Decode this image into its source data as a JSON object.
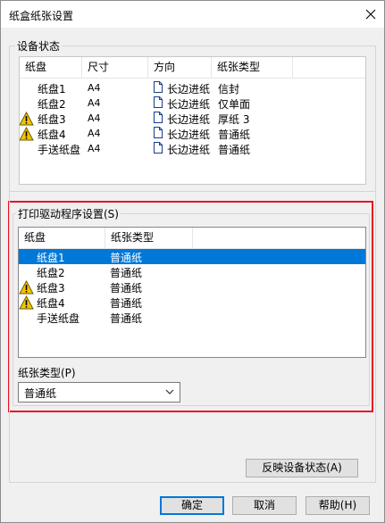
{
  "window": {
    "title": "纸盒纸张设置"
  },
  "device_status": {
    "group_label": "设备状态",
    "columns": [
      "纸盘",
      "尺寸",
      "方向",
      "纸张类型"
    ],
    "rows": [
      {
        "tray": "纸盘1",
        "size": "A4",
        "orientation": "长边进纸",
        "paper": "信封",
        "warning": false
      },
      {
        "tray": "纸盘2",
        "size": "A4",
        "orientation": "长边进纸",
        "paper": "仅单面",
        "warning": false
      },
      {
        "tray": "纸盘3",
        "size": "A4",
        "orientation": "长边进纸",
        "paper": "厚纸 3",
        "warning": true
      },
      {
        "tray": "纸盘4",
        "size": "A4",
        "orientation": "长边进纸",
        "paper": "普通纸",
        "warning": true
      },
      {
        "tray": "手送纸盘",
        "size": "A4",
        "orientation": "长边进纸",
        "paper": "普通纸",
        "warning": false
      }
    ]
  },
  "driver_settings": {
    "group_label": "打印驱动程序设置(S)",
    "columns": [
      "纸盘",
      "纸张类型"
    ],
    "rows": [
      {
        "tray": "纸盘1",
        "paper": "普通纸",
        "warning": false,
        "selected": true
      },
      {
        "tray": "纸盘2",
        "paper": "普通纸",
        "warning": false,
        "selected": false
      },
      {
        "tray": "纸盘3",
        "paper": "普通纸",
        "warning": true,
        "selected": false
      },
      {
        "tray": "纸盘4",
        "paper": "普通纸",
        "warning": true,
        "selected": false
      },
      {
        "tray": "手送纸盘",
        "paper": "普通纸",
        "warning": false,
        "selected": false
      }
    ],
    "paper_type_label": "纸张类型(P)",
    "paper_type_value": "普通纸"
  },
  "buttons": {
    "reflect": "反映设备状态(A)",
    "ok": "确定",
    "cancel": "取消",
    "help": "帮助(H)"
  },
  "colors": {
    "selection": "#0078d7",
    "highlight_box": "#e81123",
    "warning": "#f5c400"
  }
}
